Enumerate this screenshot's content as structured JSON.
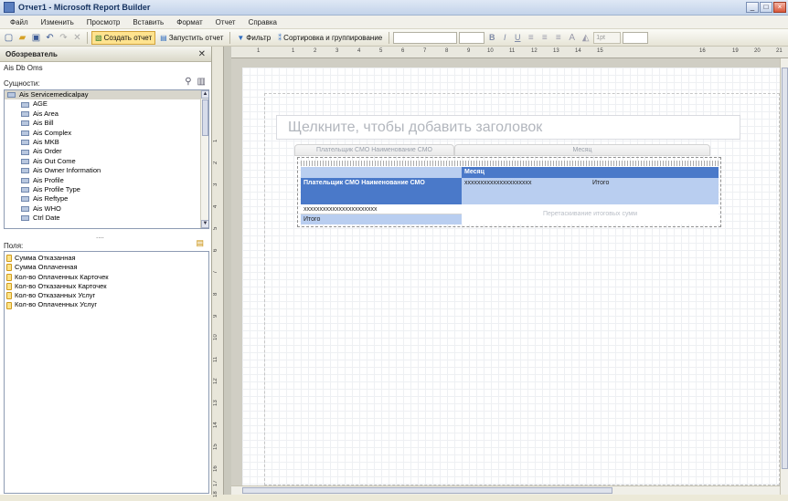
{
  "window": {
    "title": "Отчет1 - Microsoft Report Builder",
    "buttons": [
      "_",
      "□",
      "×"
    ]
  },
  "menu": [
    "Файл",
    "Изменить",
    "Просмотр",
    "Вставить",
    "Формат",
    "Отчет",
    "Справка"
  ],
  "toolbar": {
    "create_report": "Создать отчет",
    "run_report": "Запустить отчет",
    "filter": "Фильтр",
    "sort_group": "Сортировка и группирование",
    "font_size": "1pt",
    "format_b": "B",
    "format_i": "I",
    "format_u": "U"
  },
  "explorer": {
    "title": "Обозреватель",
    "model": "Ais Db Oms",
    "entities_label": "Сущности:",
    "root_entity": "Ais Servicemedicalpay",
    "entities": [
      "AGE",
      "Ais Area",
      "Ais Bill",
      "Ais Complex",
      "Ais MKB",
      "Ais Order",
      "Ais Out Come",
      "Ais Owner Information",
      "Ais Profile",
      "Ais Profile Type",
      "Ais Reftype",
      "Ais WHO",
      "Ctrl Date"
    ],
    "splitter": "....",
    "fields_label": "Поля:",
    "fields": [
      "Сумма Отказанная",
      "Сумма Оплаченная",
      "Кол-во Оплаченных Карточек",
      "Кол-во Отказанных Карточек",
      "Кол-во Отказанных Услуг",
      "Кол-во Оплаченных Услуг"
    ]
  },
  "report": {
    "title_placeholder": "Щелкните, чтобы добавить заголовок",
    "row_caption": "Плательщик СМО Наименование СМО",
    "col_caption": "Месяц",
    "col_header": "Месяц",
    "row_header": "Плательщик СМО Наименование СМО",
    "cell_value": "xxxxxxxxxxxxxxxxxxxxx",
    "total_col": "Итого",
    "row_value": "xxxxxxxxxxxxxxxxxxxxxxx",
    "total_row": "Итого",
    "drop_hint": "Перетаскивание итоговых сумм"
  },
  "hruler_numbers": [
    "1",
    "1",
    "2",
    "3",
    "4",
    "5",
    "6",
    "7",
    "8",
    "9",
    "10",
    "11",
    "12",
    "13",
    "14",
    "15",
    "16",
    "19",
    "20",
    "21"
  ],
  "vruler_numbers": [
    "1",
    "2",
    "3",
    "4",
    "5",
    "6",
    "7",
    "8",
    "9",
    "10",
    "11",
    "12",
    "13",
    "14",
    "15",
    "16",
    "17",
    "18"
  ]
}
